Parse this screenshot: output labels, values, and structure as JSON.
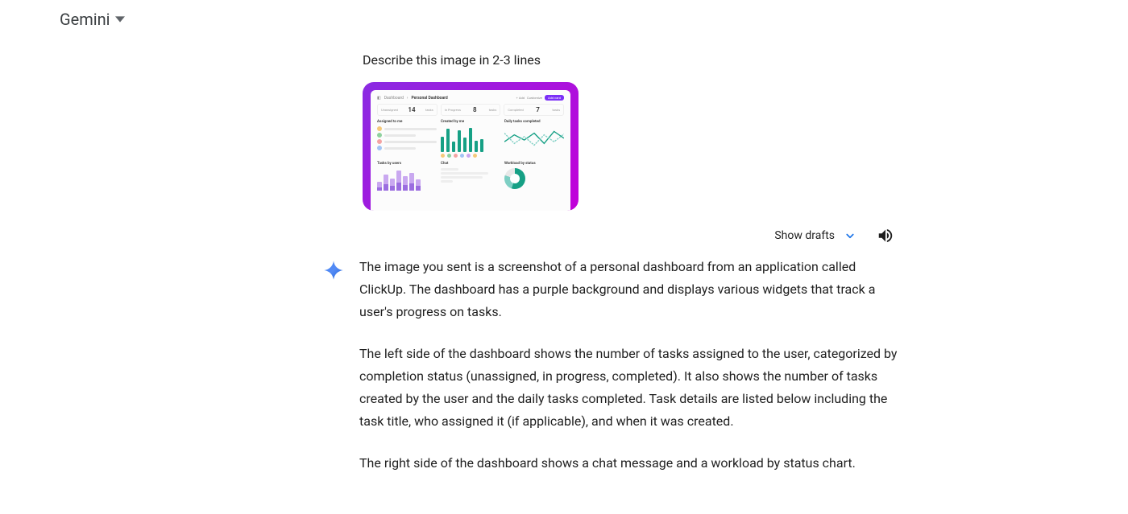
{
  "header": {
    "app_name": "Gemini"
  },
  "prompt": {
    "text": "Describe this image in 2-3 lines"
  },
  "attached_dashboard": {
    "breadcrumb": "Dashboard",
    "title": "Personal Dashboard",
    "btn_add": "+ Add",
    "btn_customize": "Customize",
    "btn_primary": "Add card",
    "stats": [
      {
        "label": "Unassigned",
        "value": "14"
      },
      {
        "label": "In Progress",
        "value": "8"
      },
      {
        "label": "Completed",
        "value": "7"
      }
    ],
    "panel_assigned": "Assigned to me",
    "panel_created": "Created by me",
    "panel_daily": "Daily tasks completed",
    "panel_tasks_by_user": "Tasks by users",
    "panel_chat": "Chat",
    "panel_workload": "Workload by status"
  },
  "actions": {
    "show_drafts": "Show drafts"
  },
  "response": {
    "p1": "The image you sent is a screenshot of a personal dashboard from an application called ClickUp. The dashboard has a purple background and displays various widgets that track a user's progress on tasks.",
    "p2": "The left side of the dashboard shows the number of tasks assigned to the user, categorized by completion status (unassigned, in progress, completed). It also shows the number of tasks created by the user and the daily tasks completed. Task details are listed below including the task title, who assigned it (if applicable), and when it was created.",
    "p3": "The right side of the dashboard shows a chat message and a workload by status chart."
  }
}
